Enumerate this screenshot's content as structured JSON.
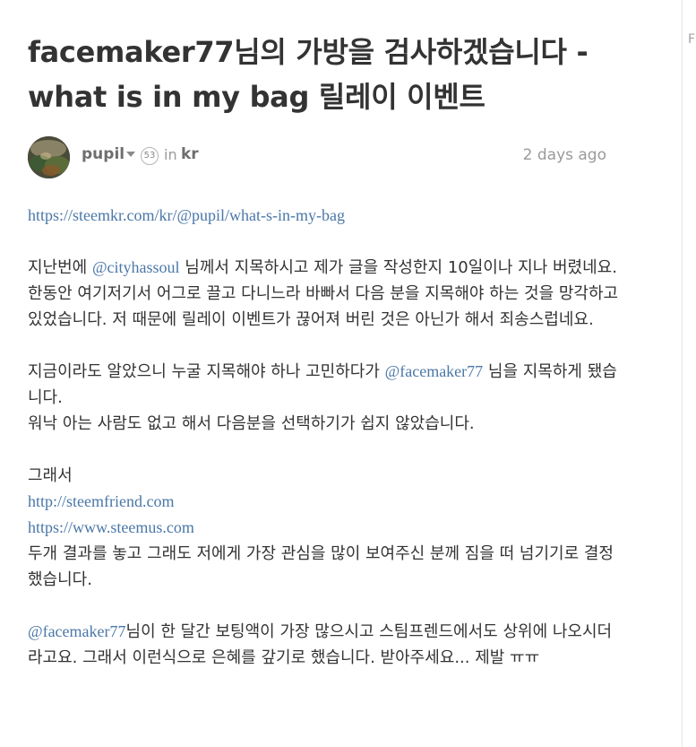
{
  "post": {
    "title": "facemaker77님의 가방을 검사하겠습니다 - what is in my bag 릴레이 이벤트",
    "author": {
      "name": "pupil",
      "reputation": "53"
    },
    "in_label": "in",
    "category": "kr",
    "timestamp": "2 days ago"
  },
  "side": {
    "letter": "F"
  },
  "body": {
    "link_bag": "https://steemkr.com/kr/@pupil/what-s-in-my-bag",
    "p1": {
      "pre": "지난번에 ",
      "mention": "@cityhassoul",
      "post": " 님께서 지목하시고 제가 글을 작성한지 10일이나 지나 버렸네요.",
      "line2": "한동안 여기저기서 어그로 끌고 다니느라 바빠서 다음 분을 지목해야 하는 것을 망각하고 있었습니다. 저 때문에 릴레이 이벤트가 끊어져 버린 것은 아닌가 해서 죄송스럽네요."
    },
    "p2": {
      "pre": "지금이라도 알았으니 누굴 지목해야 하나 고민하다가 ",
      "mention": "@facemaker77",
      "post": " 님을 지목하게 됐습니다.",
      "line2": "워낙 아는 사람도 없고 해서 다음분을 선택하기가 쉽지 않았습니다."
    },
    "p3": {
      "intro": "그래서",
      "link1": "http://steemfriend.com",
      "link2": "https://www.steemus.com",
      "text": "두개 결과를 놓고 그래도 저에게 가장 관심을 많이 보여주신 분께 짐을 떠 넘기기로 결정 했습니다."
    },
    "p4": {
      "mention": "@facemaker77",
      "text": "님이 한 달간 보팅액이 가장 많으시고 스팀프렌드에서도 상위에 나오시더라고요. 그래서 이런식으로 은혜를 갚기로 했습니다. 받아주세요... 제발 ㅠㅠ"
    }
  },
  "colors": {
    "link": "#4a77a8",
    "text": "#333333",
    "meta": "#9a9a9a"
  }
}
